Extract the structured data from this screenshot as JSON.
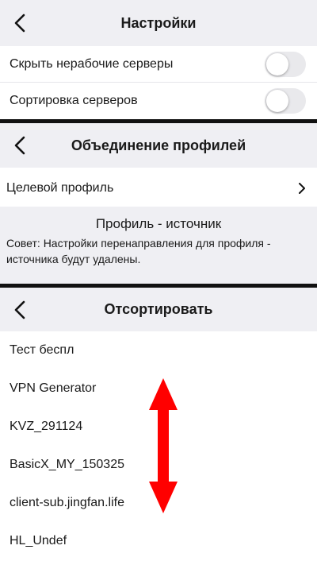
{
  "settings": {
    "title": "Настройки",
    "rows": [
      {
        "label": "Скрыть нерабочие серверы",
        "toggle": false
      },
      {
        "label": "Сортировка серверов",
        "toggle": false
      }
    ]
  },
  "merge": {
    "title": "Объединение профилей",
    "target_profile_label": "Целевой профиль",
    "source_title": "Профиль - источник",
    "hint": "Совет: Настройки перенаправления для профиля - источника будут удалены."
  },
  "sort": {
    "title": "Отсортировать",
    "items": [
      "Тест беспл",
      "VPN Generator",
      "KVZ_291124",
      "BasicX_MY_150325",
      "client-sub.jingfan.life",
      "HL_Undef"
    ]
  },
  "colors": {
    "header_bg": "#efeff3",
    "arrow_red": "#ff0000",
    "divider": "#111111"
  }
}
